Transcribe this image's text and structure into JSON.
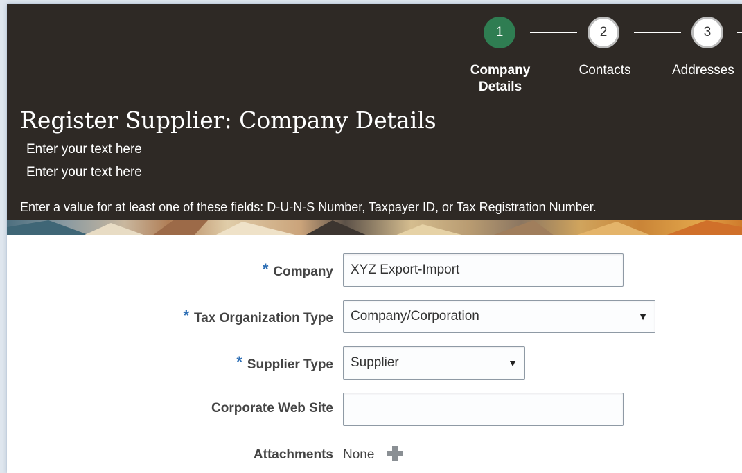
{
  "train": {
    "steps": [
      {
        "number": "1",
        "label_line1": "Company",
        "label_line2": "Details",
        "state": "active"
      },
      {
        "number": "2",
        "label_line1": "Contacts",
        "label_line2": "",
        "state": "inactive"
      },
      {
        "number": "3",
        "label_line1": "Addresses",
        "label_line2": "",
        "state": "inactive"
      }
    ]
  },
  "header": {
    "title": "Register Supplier: Company Details",
    "instruction_1": "Enter your text here",
    "instruction_2": "Enter your text here",
    "notice": "Enter a value for at least one of these fields: D-U-N-S Number, Taxpayer ID, or Tax Registration Number."
  },
  "form": {
    "required_marker": "*",
    "company": {
      "label": "Company",
      "value": "XYZ Export-Import",
      "required": true
    },
    "tax_org_type": {
      "label": "Tax Organization Type",
      "value": "Company/Corporation",
      "required": true
    },
    "supplier_type": {
      "label": "Supplier Type",
      "value": "Supplier",
      "required": true
    },
    "corporate_web_site": {
      "label": "Corporate Web Site",
      "value": "",
      "required": false
    },
    "attachments": {
      "label": "Attachments",
      "value": "None"
    }
  },
  "colors": {
    "header_bg": "#2e2925",
    "active_step": "#2f7d52",
    "required_asterisk": "#2e6fb5",
    "label_text": "#444444"
  },
  "icons": {
    "dropdown": "chevron-down-icon",
    "add": "plus-icon"
  }
}
